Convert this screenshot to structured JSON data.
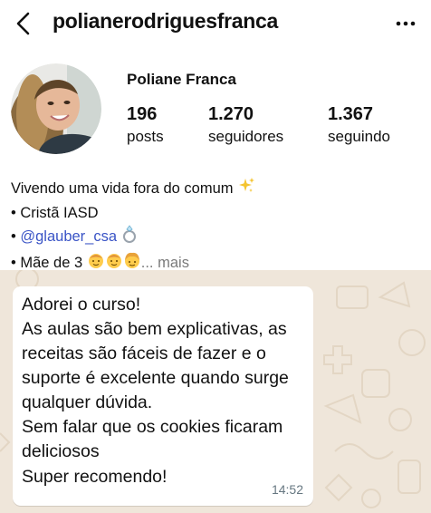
{
  "profile": {
    "username": "polianerodriguesfranca",
    "full_name": "Poliane Franca",
    "stats": [
      {
        "value": "196",
        "label": "posts"
      },
      {
        "value": "1.270",
        "label": "seguidores"
      },
      {
        "value": "1.367",
        "label": "seguindo"
      }
    ],
    "bio": {
      "line1": "Vivendo uma vida fora do comum",
      "line2": "• Cristã IASD",
      "line3_prefix": "• ",
      "line3_mention": "@glauber_csa",
      "line4": "• Mãe de 3",
      "line4_more": "... mais"
    },
    "icons": [
      "back-arrow-icon",
      "more-options-icon",
      "sparkles-icon",
      "ring-icon",
      "child-emoji-icon"
    ],
    "colors": {
      "mention": "#3a54c6",
      "more": "#7a7a7a"
    }
  },
  "whatsapp": {
    "message_lines": [
      "Adorei o curso!",
      "As aulas são bem explicativas, as",
      "receitas são fáceis de fazer e o",
      "suporte é excelente quando surge",
      "qualquer dúvida.",
      "Sem falar que os cookies ficaram",
      "deliciosos",
      "Super recomendo!"
    ],
    "time": "14:52",
    "colors": {
      "background": "#efe6da",
      "bubble": "#ffffff",
      "time": "#667781"
    }
  }
}
